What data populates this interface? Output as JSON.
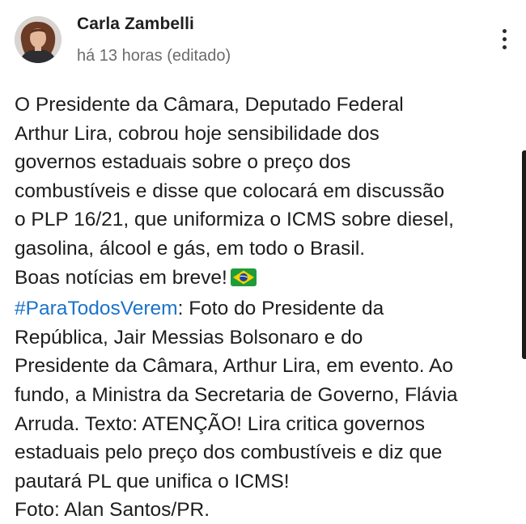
{
  "author": {
    "name": "Carla Zambelli",
    "timestamp": "há 13 horas (editado)",
    "avatar_icon": "profile-photo"
  },
  "menu": {
    "icon": "more-vertical-icon"
  },
  "post": {
    "lines": [
      "O Presidente da Câmara, Deputado Federal",
      "Arthur Lira, cobrou hoje sensibilidade dos",
      "governos estaduais sobre o preço dos",
      "combustíveis e disse que colocará em discussão",
      "o PLP 16/21, que uniformiza o ICMS sobre diesel,",
      "gasolina, álcool e gás, em todo o Brasil.",
      "Boas notícias em breve!"
    ],
    "flag_emoji": "brazil-flag-icon",
    "hashtag": "#ParaTodosVerem",
    "hashtag_rest": ": Foto do Presidente da",
    "desc_lines": [
      "República, Jair Messias Bolsonaro e do",
      "Presidente da Câmara, Arthur Lira, em evento. Ao",
      "fundo, a Ministra da Secretaria de Governo, Flávia",
      "Arruda. Texto: ATENÇÃO! Lira critica governos",
      "estaduais pelo preço dos combustíveis e diz que",
      "pautará PL que unifica o ICMS!",
      "Foto: Alan Santos/PR."
    ]
  },
  "colors": {
    "hashtag": "#1a73c8",
    "meta_text": "#6b6b6b"
  }
}
